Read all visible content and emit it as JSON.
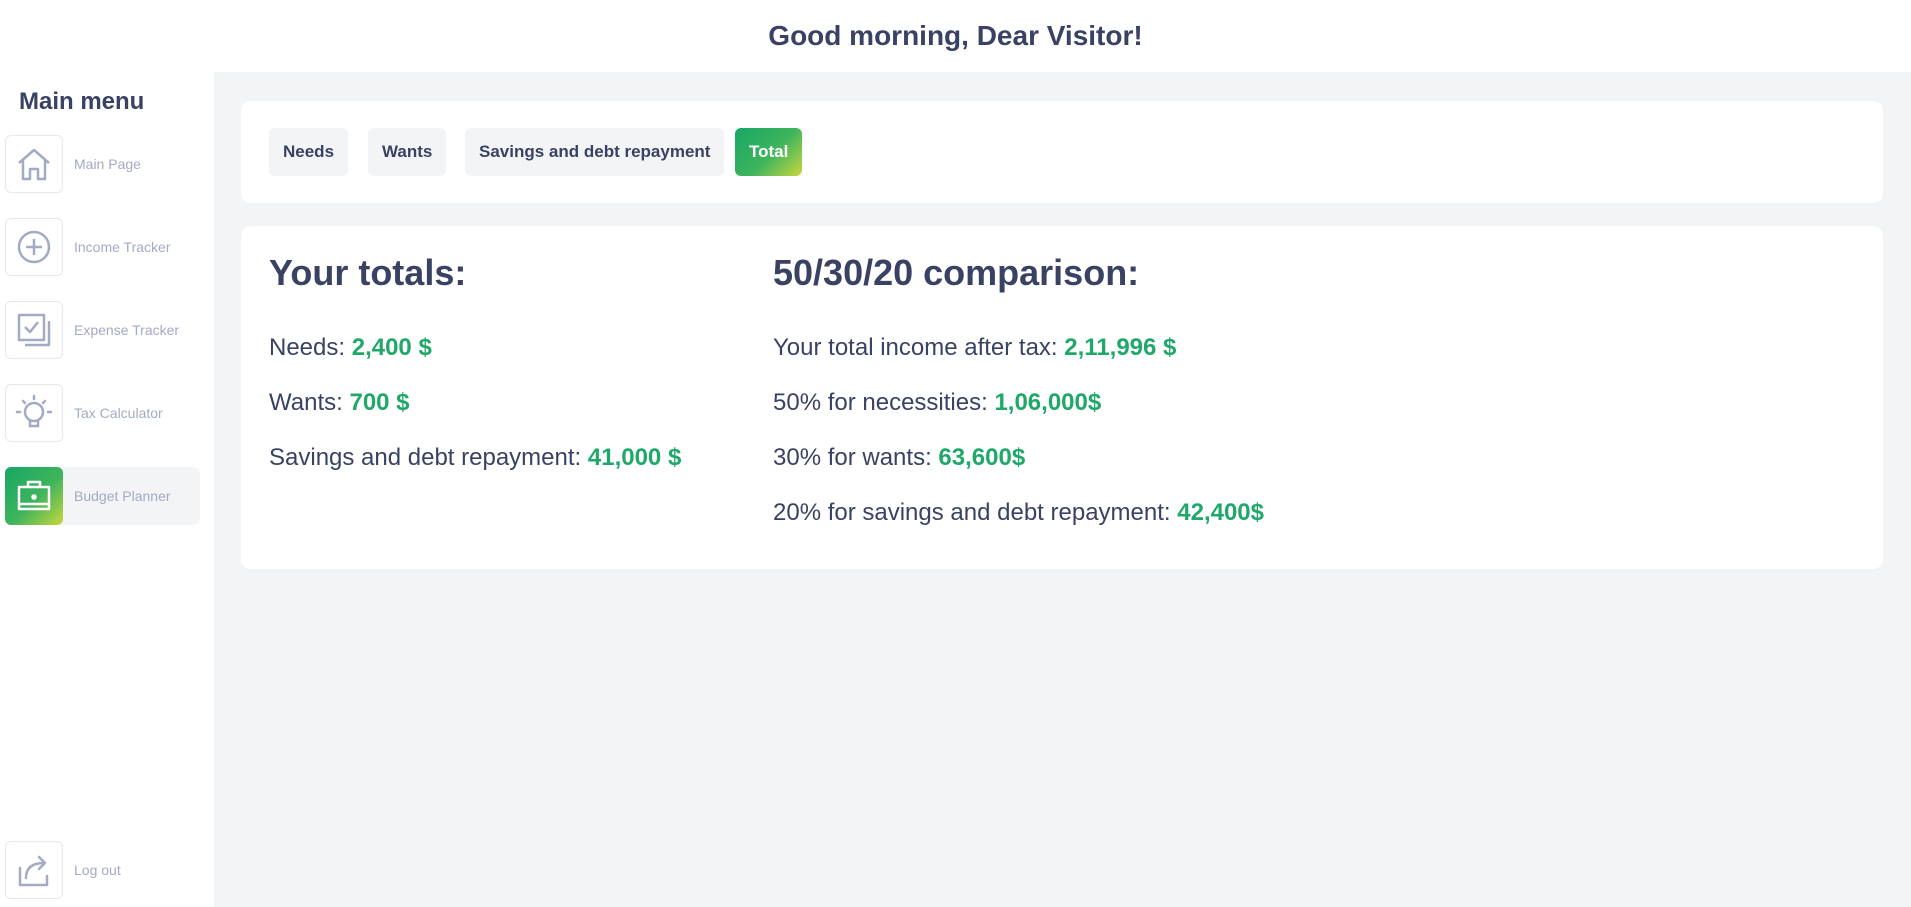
{
  "header": {
    "greeting": "Good morning, Dear Visitor!"
  },
  "sidebar": {
    "title": "Main menu",
    "items": [
      {
        "label": "Main Page",
        "icon": "home-icon"
      },
      {
        "label": "Income Tracker",
        "icon": "plus-circle-icon"
      },
      {
        "label": "Expense Tracker",
        "icon": "checkbox-stack-icon"
      },
      {
        "label": "Tax Calculator",
        "icon": "lightbulb-icon"
      },
      {
        "label": "Budget Planner",
        "icon": "briefcase-icon",
        "active": true
      }
    ],
    "logout": {
      "label": "Log out",
      "icon": "share-icon"
    }
  },
  "tabs": [
    {
      "label": "Needs"
    },
    {
      "label": "Wants"
    },
    {
      "label": "Savings and debt repayment"
    },
    {
      "label": "Total",
      "active": true
    }
  ],
  "totals": {
    "heading": "Your totals:",
    "rows": [
      {
        "label": "Needs: ",
        "value": "2,400 $"
      },
      {
        "label": "Wants: ",
        "value": "700 $"
      },
      {
        "label": "Savings and debt repayment: ",
        "value": "41,000 $"
      }
    ]
  },
  "comparison": {
    "heading": "50/30/20 comparison:",
    "rows": [
      {
        "label": "Your total income after tax: ",
        "value": "2,11,996 $"
      },
      {
        "label": "50% for necessities: ",
        "value": "1,06,000$"
      },
      {
        "label": "30% for wants: ",
        "value": "63,600$"
      },
      {
        "label": "20% for savings and debt repayment: ",
        "value": "42,400$"
      }
    ]
  },
  "colors": {
    "accent_green": "#20a86a",
    "text_dark": "#3a4264",
    "muted": "#a3abc4",
    "gradient_start": "#16a765",
    "gradient_end": "#c8d73e"
  }
}
